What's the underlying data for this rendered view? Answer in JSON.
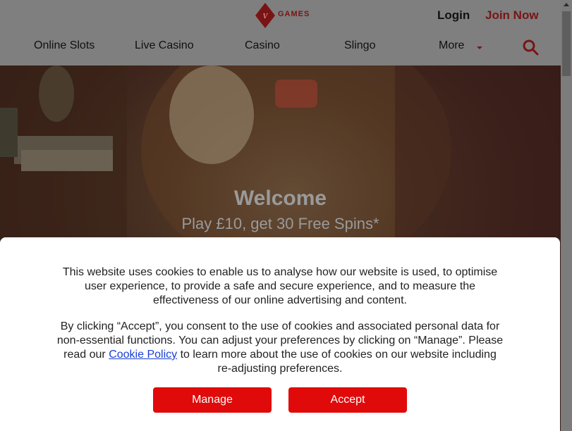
{
  "header": {
    "brand_games": "GAMES",
    "login_label": "Login",
    "join_label": "Join Now",
    "nav": [
      "Online Slots",
      "Live Casino",
      "Casino",
      "Slingo",
      "More"
    ],
    "search_icon": "search-icon"
  },
  "hero": {
    "welcome": "Welcome",
    "offer": "Play £10, get 30 Free Spins*"
  },
  "cookie": {
    "paragraph1": "This website uses cookies to enable us to analyse how our website is used, to optimise user experience, to provide a safe and secure experience, and to measure the effectiveness of our online advertising and content.",
    "paragraph2_before": "By clicking “Accept”, you consent to the use of cookies and associated personal data for non-essential functions. You can adjust your preferences by clicking on “Manage”. Please read our ",
    "paragraph2_link": "Cookie Policy",
    "paragraph2_after": " to learn more about the use of cookies on our website including re-adjusting preferences.",
    "manage_label": "Manage",
    "accept_label": "Accept"
  },
  "colors": {
    "accent_red": "#e10a0a",
    "brand_dark_red": "#7a1414",
    "link_blue": "#1a3ed6"
  }
}
